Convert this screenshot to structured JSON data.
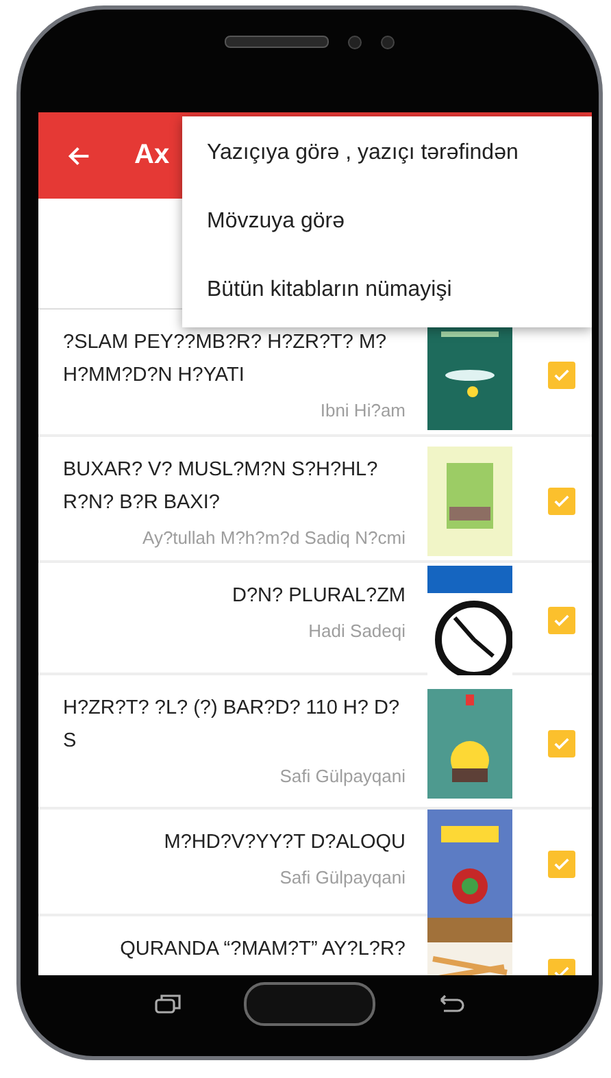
{
  "app_bar": {
    "title": "Ax"
  },
  "menu": {
    "items": [
      {
        "label": "Yazıçıya görə , yazıçı tərəfindən"
      },
      {
        "label": "Mövzuya görə"
      },
      {
        "label": "Bütün kitabların nümayişi"
      }
    ]
  },
  "books": [
    {
      "title": "?SLAM PEY??MB?R? H?ZR?T? M? H?MM?D?N H?YATI",
      "author": "Ibni Hi?am",
      "checked": true
    },
    {
      "title": "BUXAR? V? MUSL?M?N S?H?HL? R?N? B?R BAXI?",
      "author": "Ay?tullah M?h?m?d Sadiq N?cmi",
      "checked": true
    },
    {
      "title": "D?N? PLURAL?ZM",
      "author": "Hadi Sadeqi",
      "checked": true
    },
    {
      "title": "H?ZR?T? ?L? (?) BAR?D? 110 H? D?S",
      "author": "Safi Gülpayqani",
      "checked": true
    },
    {
      "title": "M?HD?V?YY?T D?ALOQU",
      "author": "Safi Gülpayqani",
      "checked": true
    },
    {
      "title": "QURANDA “?MAM?T” AY?L?R?",
      "checked": true
    }
  ]
}
